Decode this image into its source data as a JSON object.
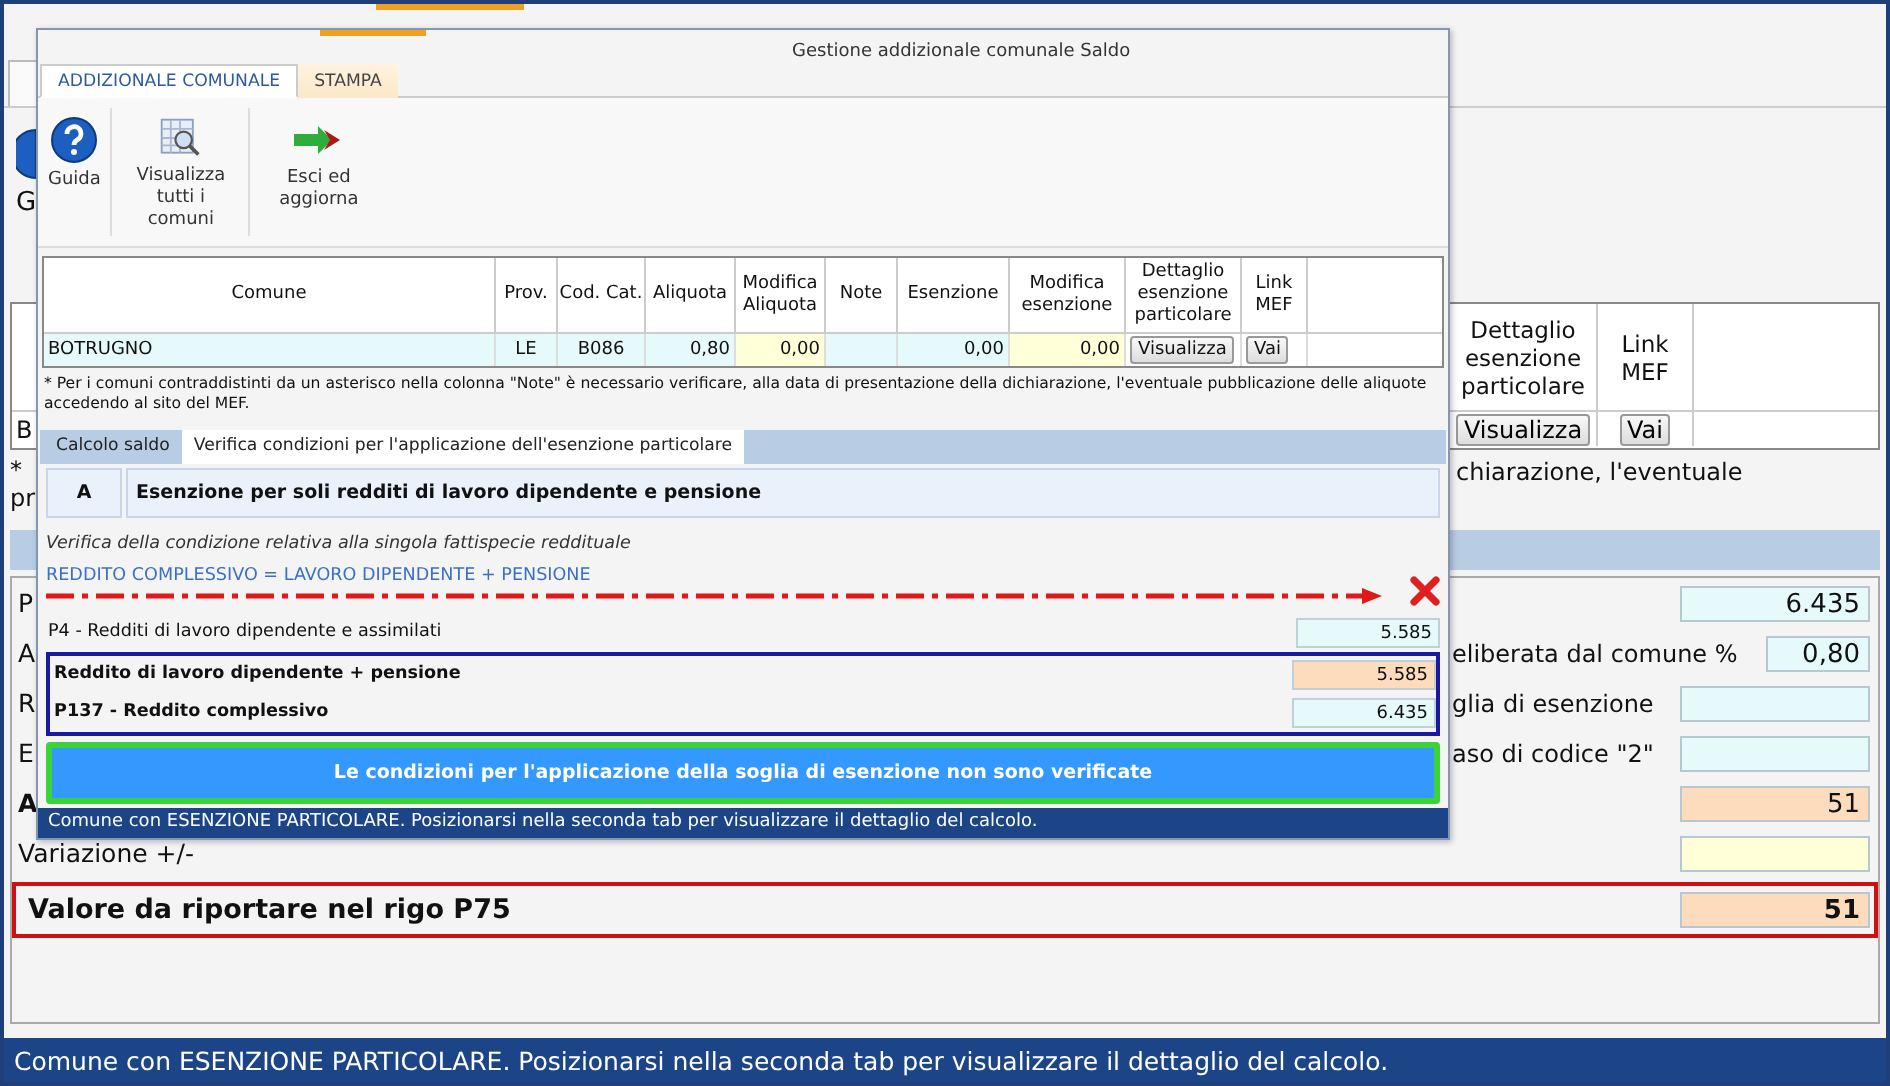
{
  "background": {
    "ribbon_label": "G",
    "table": {
      "columns": [
        "Dettaglio esenzione particolare",
        "Link MEF"
      ],
      "first_cell": "B",
      "buttons": [
        "Visualizza",
        "Vai"
      ]
    },
    "note_lines": [
      "*",
      "pr"
    ],
    "note_tail": "chiarazione, l'eventuale",
    "rows": [
      {
        "label": "P",
        "value": "6.435",
        "kind": "calculated",
        "bold": false
      },
      {
        "label": "A",
        "tail": "eliberata dal comune %",
        "value": "0,80",
        "kind": "rate",
        "bold": false
      },
      {
        "label": "R",
        "tail": "glia di esenzione",
        "kind": "calculated",
        "bold": false
      },
      {
        "label": "E",
        "tail": "aso di codice \"2\"",
        "kind": "calculated",
        "bold": false
      },
      {
        "label": "A",
        "value": "51",
        "kind": "result",
        "bold": true
      },
      {
        "label": "Variazione +/-",
        "kind": "editable",
        "bold": false
      }
    ],
    "total": {
      "label": "Valore da riportare nel rigo P75",
      "value": "51",
      "kind": "result"
    },
    "status_bar": "Comune con ESENZIONE PARTICOLARE. Posizionarsi nella seconda tab per visualizzare il dettaglio del calcolo."
  },
  "dialog": {
    "title": "Gestione addizionale comunale Saldo",
    "tabs": [
      {
        "label": "ADDIZIONALE COMUNALE",
        "selected": true
      },
      {
        "label": "STAMPA",
        "selected": false
      }
    ],
    "ribbon": [
      {
        "label": "Guida",
        "kind": "help"
      },
      {
        "label": "Visualizza tutti i comuni",
        "kind": "grid"
      },
      {
        "label": "Esci ed aggiorna",
        "kind": "exit"
      }
    ],
    "table": {
      "columns": [
        "Comune",
        "Prov.",
        "Cod. Cat.",
        "Aliquota",
        "Modifica Aliquota",
        "Note",
        "Esenzione",
        "Modifica esenzione",
        "Dettaglio esenzione particolare",
        "Link MEF"
      ],
      "rows": [
        {
          "cells": [
            {
              "text": "BOTRUGNO",
              "kind": "name"
            },
            {
              "text": "LE",
              "kind": "calculated"
            },
            {
              "text": "B086",
              "kind": "calculated"
            },
            {
              "text": "0,80",
              "kind": "calculated"
            },
            {
              "text": "0,00",
              "kind": "editable"
            },
            {
              "kind": "calculated"
            },
            {
              "text": "0,00",
              "kind": "calculated"
            },
            {
              "text": "0,00",
              "kind": "editable"
            },
            {
              "text": "Visualizza",
              "kind": "button"
            },
            {
              "text": "Vai",
              "kind": "button"
            }
          ]
        }
      ]
    },
    "note": "* Per i comuni contraddistinti da un asterisco nella colonna \"Note\" è necessario verificare,  alla data di presentazione della dichiarazione, l'eventuale pubblicazione delle aliquote accedendo al sito del MEF.",
    "subtabs": [
      {
        "label": "Calcolo saldo",
        "selected": false
      },
      {
        "label": "Verifica condizioni per l'applicazione dell'esenzione particolare",
        "selected": true
      }
    ],
    "section": {
      "letter": "A",
      "title": "Esenzione per soli redditi di lavoro dipendente e pensione"
    },
    "caption": "Verifica della condizione relativa alla singola fattispecie reddituale",
    "condition": {
      "text": "REDDITO COMPLESSIVO = LAVORO DIPENDENTE + PENSIONE",
      "verified": false
    },
    "rows": [
      {
        "label": "P4 - Redditi di lavoro dipendente e assimilati",
        "value": "5.585",
        "kind": "calculated"
      }
    ],
    "comparison_rows": [
      {
        "label": "Reddito di lavoro dipendente + pensione",
        "value": "5.585",
        "kind": "result"
      },
      {
        "label": "P137 - Reddito complessivo",
        "value": "6.435",
        "kind": "calculated"
      }
    ],
    "result_button": "Le condizioni per l'applicazione della soglia di esenzione non sono verificate",
    "status_bar": "Comune con ESENZIONE PARTICOLARE. Posizionarsi nella seconda tab per visualizzare il dettaglio del calcolo."
  }
}
